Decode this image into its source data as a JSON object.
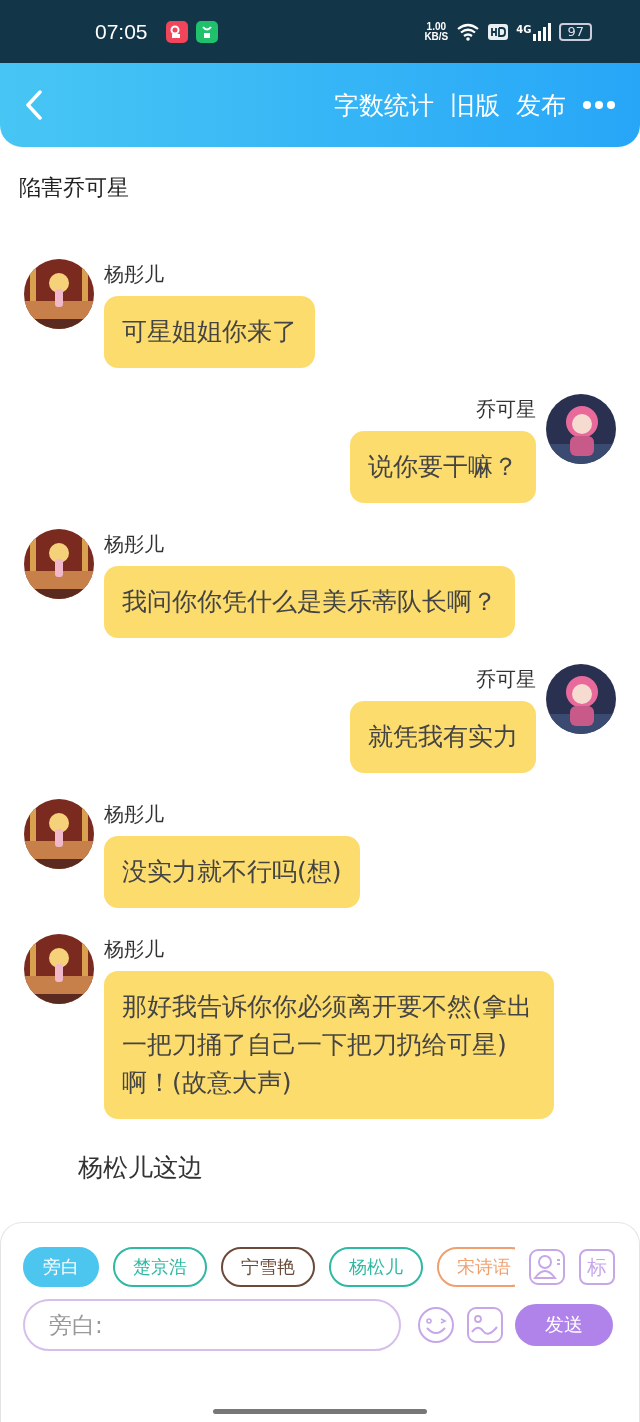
{
  "status_bar": {
    "time": "07:05",
    "speed": "1.00",
    "speed_unit": "KB/S",
    "network": "4G",
    "battery": "97"
  },
  "header": {
    "actions": [
      "字数统计",
      "旧版",
      "发布"
    ]
  },
  "title": "陷害乔可星",
  "messages": [
    {
      "kind": "bubble",
      "outgoing": false,
      "name": "杨彤儿",
      "text": "可星姐姐你来了"
    },
    {
      "kind": "bubble",
      "outgoing": true,
      "name": "乔可星",
      "text": "说你要干嘛？"
    },
    {
      "kind": "bubble",
      "outgoing": false,
      "name": "杨彤儿",
      "text": "我问你你凭什么是美乐蒂队长啊？"
    },
    {
      "kind": "bubble",
      "outgoing": true,
      "name": "乔可星",
      "text": "就凭我有实力"
    },
    {
      "kind": "bubble",
      "outgoing": false,
      "name": "杨彤儿",
      "text": "没实力就不行吗(想)"
    },
    {
      "kind": "bubble",
      "outgoing": false,
      "name": "杨彤儿",
      "text": "那好我告诉你你必须离开要不然(拿出一把刀捅了自己一下把刀扔给可星)啊！(故意大声)"
    },
    {
      "kind": "narration",
      "text": "杨松儿这边"
    }
  ],
  "roles": [
    {
      "label": "旁白",
      "selected": true,
      "color": "#4cc6ef"
    },
    {
      "label": "楚京浩",
      "selected": false,
      "color": "#2fb8a3"
    },
    {
      "label": "宁雪艳",
      "selected": false,
      "color": "#6b4a3a"
    },
    {
      "label": "杨松儿",
      "selected": false,
      "color": "#2fb8a3"
    },
    {
      "label": "宋诗语",
      "selected": false,
      "color": "#f0a070"
    }
  ],
  "tag_button": "标",
  "input": {
    "placeholder": "旁白:"
  },
  "send_button": "发送"
}
